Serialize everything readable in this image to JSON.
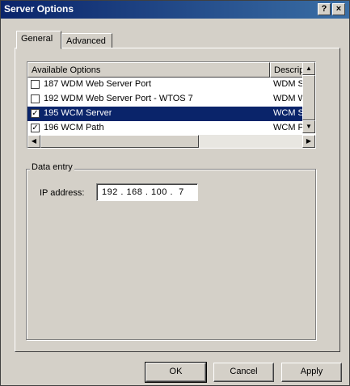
{
  "window": {
    "title": "Server Options",
    "help_glyph": "?",
    "close_glyph": "×"
  },
  "tabs": [
    {
      "label": "General",
      "active": true
    },
    {
      "label": "Advanced",
      "active": false
    }
  ],
  "options_list": {
    "columns": [
      "Available Options",
      "Description"
    ],
    "rows": [
      {
        "name": "187 WDM Web Server Port",
        "description": "WDM Serve",
        "checked": false,
        "selected": false
      },
      {
        "name": "192 WDM Web Server Port - WTOS 7",
        "description": "WDM Web",
        "checked": false,
        "selected": false
      },
      {
        "name": "195 WCM Server",
        "description": "WCM Serve",
        "checked": true,
        "selected": true
      },
      {
        "name": "196 WCM Path",
        "description": "WCM Path",
        "checked": true,
        "selected": false
      }
    ]
  },
  "data_entry": {
    "group_label": "Data entry",
    "ip_label": "IP address:",
    "ip_value": "192 . 168 . 100 .  7"
  },
  "buttons": {
    "ok": "OK",
    "cancel": "Cancel",
    "apply": "Apply"
  },
  "colors": {
    "selection": "#0a246a",
    "face": "#d4d0c8"
  }
}
